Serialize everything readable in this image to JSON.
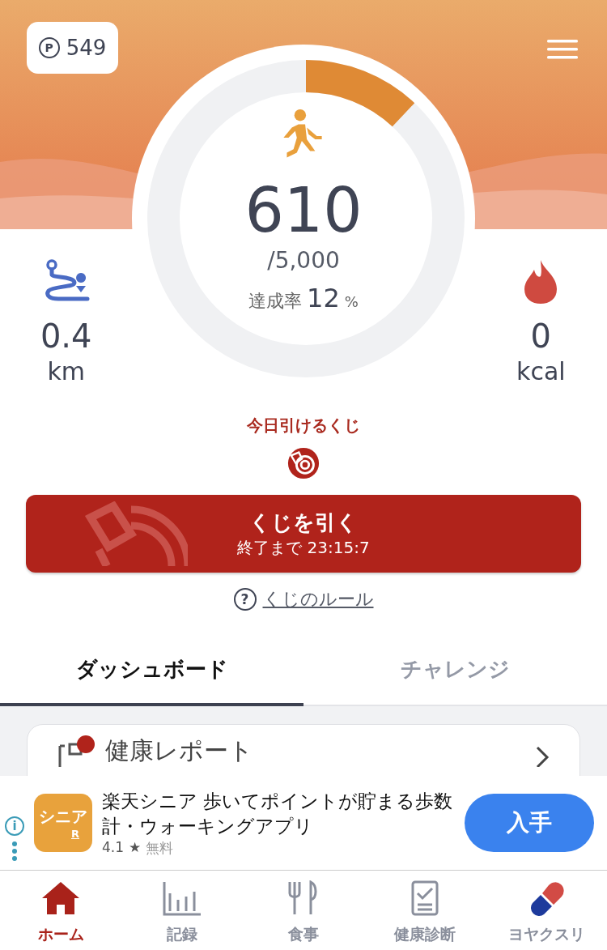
{
  "points": {
    "glyph": "P",
    "value": "549"
  },
  "steps": {
    "value": "610",
    "goal": "/5,000",
    "rate_label": "達成率",
    "rate": "12",
    "rate_unit": "%",
    "level": 0.12
  },
  "stats": [
    {
      "kind": "distance",
      "value": "0.4",
      "unit": "km"
    },
    {
      "kind": "calories",
      "value": "0",
      "unit": "kcal"
    }
  ],
  "lottery": {
    "heading": "今日引けるくじ",
    "button_title": "くじを引く",
    "button_subtitle": "終了まで 23:15:7",
    "help_glyph": "?",
    "rules_link": "くじのルール"
  },
  "tabs": [
    {
      "label": "ダッシュボード",
      "selected": true
    },
    {
      "label": "チャレンジ",
      "selected": false
    }
  ],
  "card": {
    "title": "健康レポート"
  },
  "ad": {
    "icon_text": "シニア",
    "icon_mark": "R",
    "title": "楽天シニア 歩いてポイントが貯まる歩数計・ウォーキングアプリ",
    "rating": "4.1",
    "star": "★",
    "price": "無料",
    "button": "入手",
    "info_glyph": "i"
  },
  "nav": [
    {
      "kind": "home",
      "label": "ホーム",
      "selected": true
    },
    {
      "kind": "records",
      "label": "記録",
      "selected": false
    },
    {
      "kind": "meals",
      "label": "食事",
      "selected": false
    },
    {
      "kind": "checkup",
      "label": "健康診断",
      "selected": false
    },
    {
      "kind": "medicine",
      "label": "ヨヤクスリ",
      "selected": false
    }
  ]
}
